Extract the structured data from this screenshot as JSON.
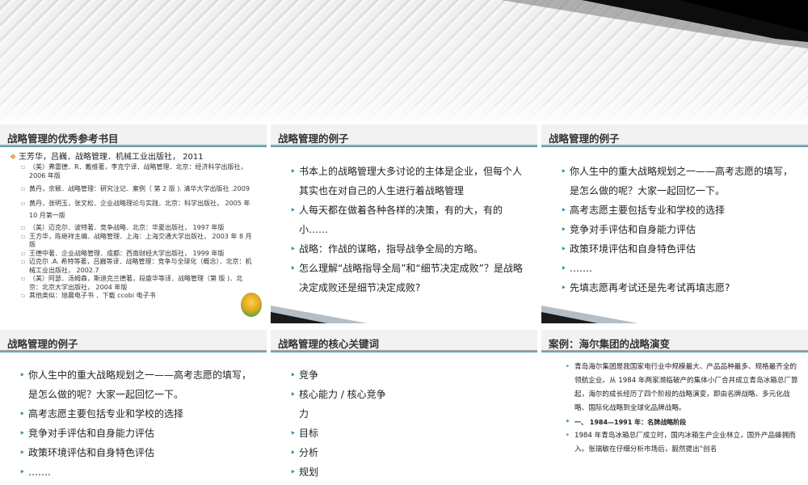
{
  "slides": [
    {
      "title": "战略管理的优秀参考书目",
      "lead": "王芳华，吕巍．战略管理．机械工业出版社， 2011",
      "refs": [
        "（美）弗雷德．R．戴维著，李克宁译．战略管理．北京：经济科学出版社， 2006 年版",
        "黄丹，余颖．战略管理：研究注记．案例（ 第 2 版 ). 清华大学出版社 .2009",
        "黄丹，张明玉，张文松．企业战略理论与实践．北京：科学出版社， 2005 年 10 月第一版",
        "（美）迈克尔．波特著．竞争战略．北京：华夏出版社， 1997 年版",
        "王方华，陈继祥主编．战略管理．上海：上海交通大学出版社， 2003 年 8 月版",
        "王德中著．企业战略管理．成都：西南财经大学出版社， 1999 年版",
        "迈克尔 .A. 希特等著，吕巍等译．战略管理：竞争与全球化（概念）．北京：机械工业出版社， 2002.7",
        "（美）阿瑟．汤姆森，斯迪克兰德著，段盛华等译．战略管理（第 版 )．北京：北京大学出版社， 2004 年版",
        "其他类似：旭晨电子书 ．下载 ccobi 电子书"
      ]
    },
    {
      "title": "战略管理的例子",
      "items": [
        "书本上的战略管理大多讨论的主体是企业，但每个人其实也在对自己的人生进行着战略管理",
        "人每天都在做着各种各样的决策，有的大，有的小……",
        "战略：作战的谋略，指导战争全局的方略。",
        "怎么理解“战略指导全局”和“细节决定成败”？是战略决定成败还是细节决定成败?"
      ]
    },
    {
      "title": "战略管理的例子",
      "items": [
        "你人生中的重大战略规划之一——高考志愿的填写，是怎么做的呢？大家一起回忆一下。",
        "高考志愿主要包括专业和学校的选择",
        "竞争对手评估和自身能力评估",
        "政策环境评估和自身特色评估",
        "…….",
        "先填志愿再考试还是先考试再填志愿?"
      ]
    },
    {
      "title": "战略管理的例子",
      "items": [
        "你人生中的重大战略规划之一——高考志愿的填写，是怎么做的呢？大家一起回忆一下。",
        "高考志愿主要包括专业和学校的选择",
        "竞争对手评估和自身能力评估",
        "政策环境评估和自身特色评估",
        "……."
      ]
    },
    {
      "title": "战略管理的核心关键词",
      "items": [
        "竞争",
        "核心能力 / 核心竞争力",
        "目标",
        "分析",
        "规划"
      ]
    },
    {
      "title": "案例：海尔集团的战略演变",
      "items": [
        "青岛海尔集团是我国家电行业中规模最大、产品品种最多、规格最齐全的领航企业。从 1984 年两家濒临破产的集体小厂合并成立青岛冰箱总厂算起，海尔的成长经历了四个阶段的战略演变，即由名牌战略、多元化战略、国际化战略到全球化品牌战略。",
        "一、 1984—1991 年：名牌战略阶段",
        "1984 年青岛冰箱总厂成立时，国内冰箱生产企业林立，国外产品蜂拥而入。张瑞敏在仔细分析市场后，毅然提出“创名"
      ]
    }
  ]
}
